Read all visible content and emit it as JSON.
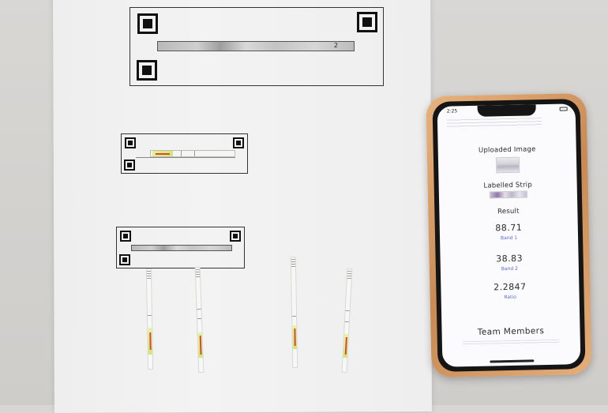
{
  "phone": {
    "status_time": "2:25",
    "uploaded_image_label": "Uploaded Image",
    "labelled_strip_label": "Labelled Strip",
    "result_heading": "Result",
    "band1_value": "88.71",
    "band1_label": "Band 1",
    "band2_value": "38.83",
    "band2_label": "Band 2",
    "ratio_value": "2.2847",
    "ratio_label": "Ratio",
    "team_members_label": "Team Members"
  },
  "paper": {
    "card_numbers": [
      "2"
    ]
  },
  "colors": {
    "phone_case": "#d99b62",
    "caption_blue": "#5a6ad0",
    "strip_pad": "#dbe97a",
    "arrow_red": "#d8483a"
  }
}
